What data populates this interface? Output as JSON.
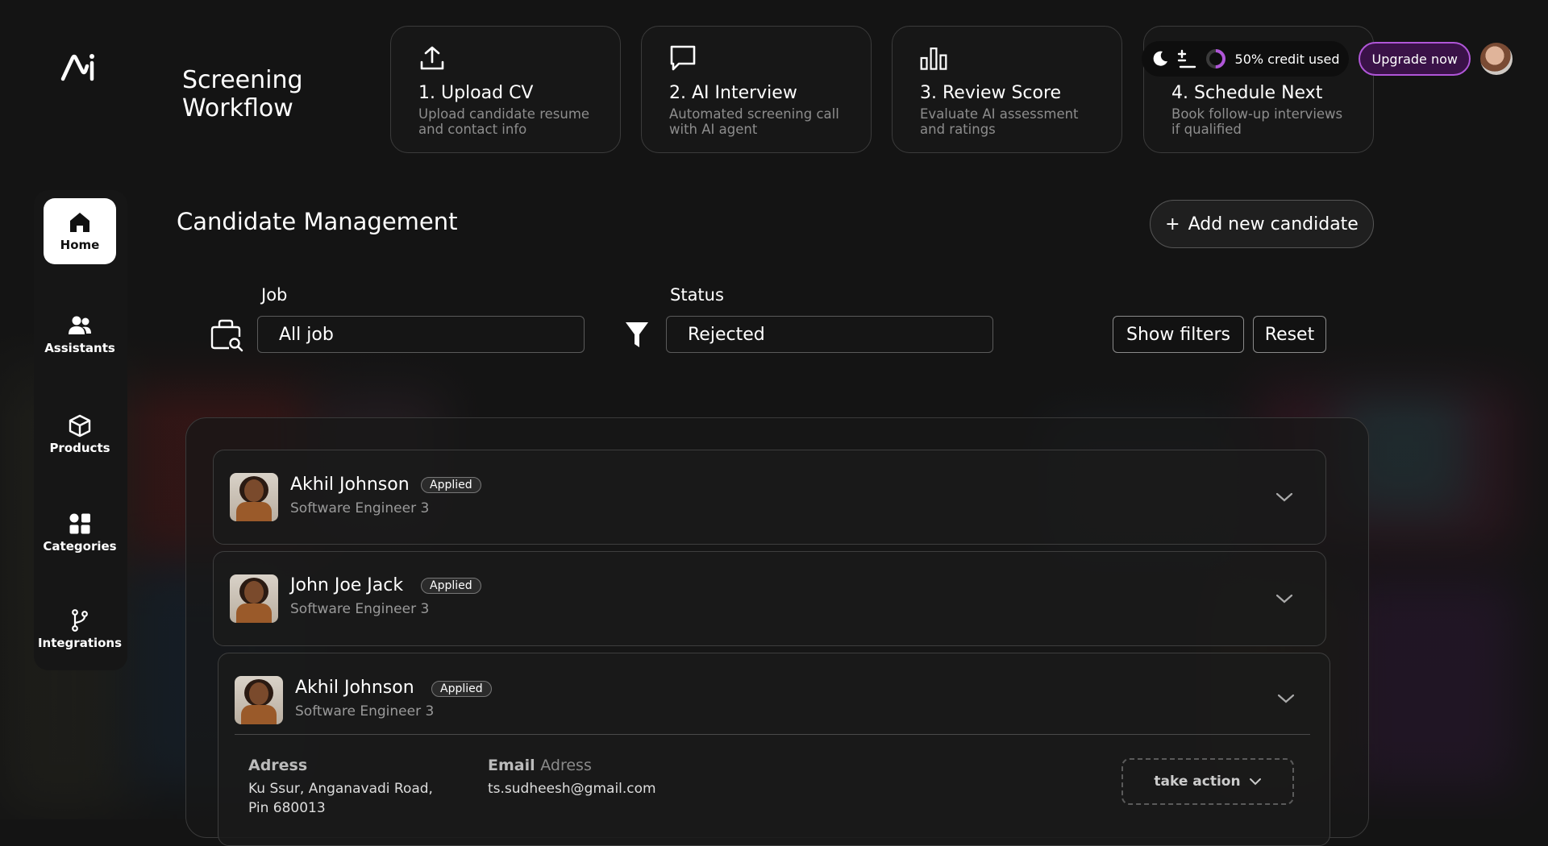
{
  "sidebar": {
    "items": [
      {
        "label": "Home",
        "icon": "home-icon"
      },
      {
        "label": "Assistants",
        "icon": "users-icon"
      },
      {
        "label": "Products",
        "icon": "box-icon"
      },
      {
        "label": "Categories",
        "icon": "grid-icon"
      },
      {
        "label": "Integrations",
        "icon": "branch-icon"
      }
    ]
  },
  "workflow": {
    "title_line1": "Screening",
    "title_line2": "Workflow",
    "steps": [
      {
        "title": "1. Upload CV",
        "desc_line1": "Upload candidate resume",
        "desc_line2": "and contact info",
        "icon": "upload-icon"
      },
      {
        "title": "2. AI Interview",
        "desc_line1": "Automated screening call",
        "desc_line2": "with AI agent",
        "icon": "chat-icon"
      },
      {
        "title": "3. Review Score",
        "desc_line1": "Evaluate AI assessment",
        "desc_line2": "and ratings",
        "icon": "bar-chart-icon"
      },
      {
        "title": "4. Schedule Next",
        "desc_line1": "Book follow-up interviews",
        "desc_line2": "if qualified",
        "icon": "calendar-icon"
      }
    ]
  },
  "topbar": {
    "credit_text": "50% credit used",
    "credit_fraction": 0.5,
    "upgrade_label": "Upgrade now",
    "accent": "#b056d8"
  },
  "main": {
    "title": "Candidate Management",
    "add_button": "Add new candidate",
    "filters": {
      "job_label": "Job",
      "job_value": "All job",
      "status_label": "Status",
      "status_value": "Rejected",
      "show_filters": "Show filters",
      "reset": "Reset"
    },
    "candidates": [
      {
        "name": "Akhil Johnson",
        "badge": "Applied",
        "role": "Software Engineer 3"
      },
      {
        "name": "John Joe Jack",
        "badge": "Applied",
        "role": "Software Engineer 3"
      },
      {
        "name": "Akhil Johnson",
        "badge": "Applied",
        "role": "Software Engineer 3",
        "details": {
          "address_label": "Adress",
          "address_line1": "Ku Ssur, Anganavadi Road,",
          "address_line2": "Pin 680013",
          "email_label_bold": "Email",
          "email_label_light": "Adress",
          "email": "ts.sudheesh@gmail.com",
          "action_label": "take action"
        }
      }
    ]
  }
}
